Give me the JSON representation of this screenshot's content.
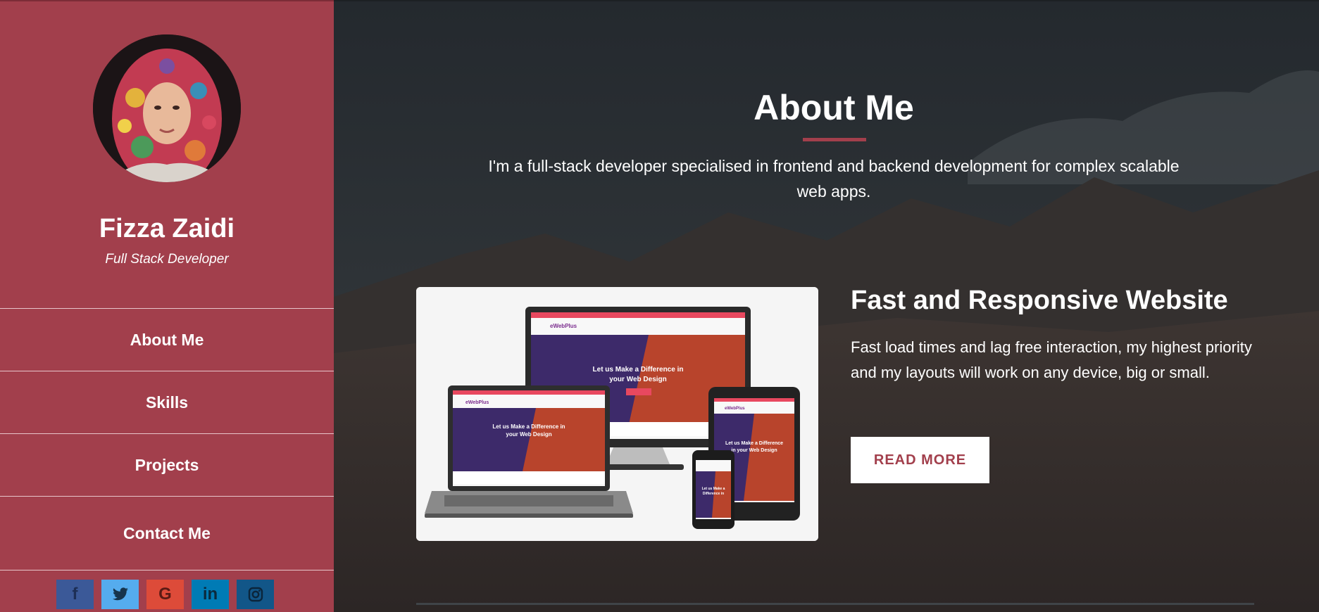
{
  "profile": {
    "name": "Fizza Zaidi",
    "role": "Full Stack Developer",
    "avatar_icon": "profile-photo"
  },
  "nav": {
    "items": [
      {
        "label": "About Me"
      },
      {
        "label": "Skills"
      },
      {
        "label": "Projects"
      },
      {
        "label": "Contact Me"
      }
    ]
  },
  "socials": [
    {
      "name": "facebook",
      "glyph": "f",
      "color": "#3b5998"
    },
    {
      "name": "twitter",
      "glyph": "🐦",
      "color": "#55acee"
    },
    {
      "name": "google",
      "glyph": "G",
      "color": "#dd4b39"
    },
    {
      "name": "linkedin",
      "glyph": "in",
      "color": "#007bb5"
    },
    {
      "name": "instagram",
      "glyph": "◎",
      "color": "#125688"
    }
  ],
  "about": {
    "title": "About Me",
    "intro": "I'm a full-stack developer specialised in frontend and backend development for complex scalable web apps."
  },
  "feature": {
    "title": "Fast and Responsive Website",
    "text": "Fast load times and lag free interaction, my highest priority and my layouts will work on any device, big or small.",
    "button": "READ MORE",
    "mockup": {
      "brand": "eWebPlus",
      "headline": "Let us Make a Difference in your Web Design"
    }
  },
  "colors": {
    "accent": "#a23f4c",
    "sidebar": "#a23f4c",
    "button_text": "#a23f4c"
  }
}
